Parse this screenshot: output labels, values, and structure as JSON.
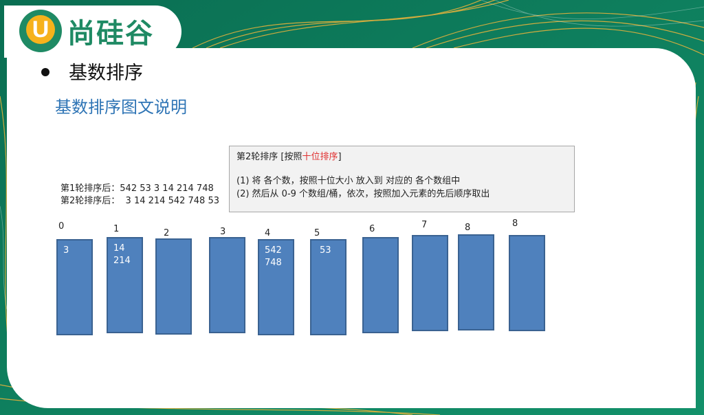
{
  "logo": {
    "letter": "U",
    "text": "尚硅谷"
  },
  "title": "基数排序",
  "subtitle": "基数排序图文说明",
  "note": {
    "heading_prefix": "第2轮排序  [按照",
    "heading_highlight": "十位排序",
    "heading_suffix": "]",
    "line1": "(1) 将 各个数，按照十位大小 放入到 对应的 各个数组中",
    "line2": "(2)  然后从 0-9 个数组/桶，依次，按照加入元素的先后顺序取出"
  },
  "rounds": {
    "round1_label": "第1轮排序后：",
    "round1_values": "542 53 3 14 214 748",
    "round2_label": "第2轮排序后：",
    "round2_values": "3 14 214 542 748 53"
  },
  "buckets": [
    {
      "label": "0",
      "items": [
        "3"
      ]
    },
    {
      "label": "1",
      "items": [
        "14",
        "214"
      ]
    },
    {
      "label": "2",
      "items": []
    },
    {
      "label": "3",
      "items": []
    },
    {
      "label": "4",
      "items": [
        "542",
        "748"
      ]
    },
    {
      "label": "5",
      "items": [
        "53"
      ]
    },
    {
      "label": "6",
      "items": []
    },
    {
      "label": "7",
      "items": []
    },
    {
      "label": "8",
      "items": []
    },
    {
      "label": "8",
      "items": []
    }
  ],
  "colors": {
    "bucket": "#4f81bd",
    "accent": "#2e74b5",
    "highlight": "#e03030",
    "bg": "#0b7f5f"
  }
}
